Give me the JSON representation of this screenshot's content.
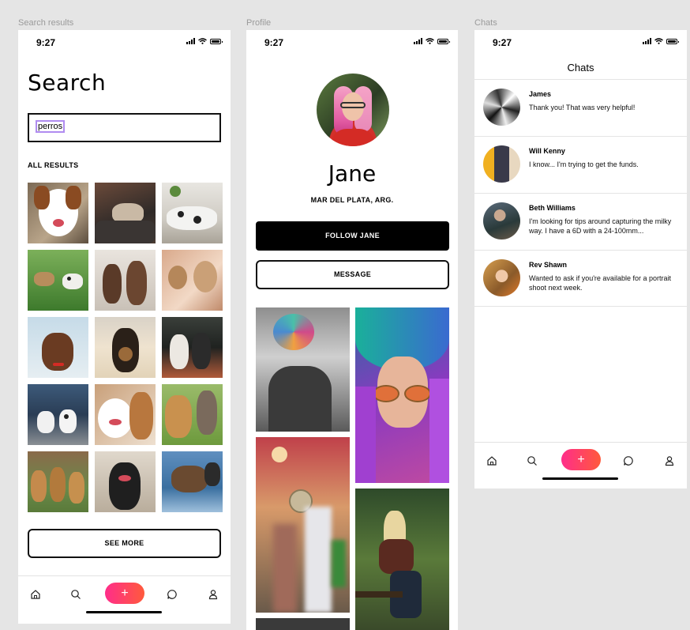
{
  "frames": {
    "search_label": "Search results",
    "profile_label": "Profile",
    "chats_label": "Chats"
  },
  "status": {
    "time": "9:27"
  },
  "search": {
    "title": "Search",
    "query": "perros",
    "section": "ALL RESULTS",
    "see_more": "SEE MORE"
  },
  "profile": {
    "name": "Jane",
    "location": "MAR DEL PLATA, ARG.",
    "follow": "FOLLOW JANE",
    "message": "MESSAGE"
  },
  "chats": {
    "title": "Chats",
    "items": [
      {
        "name": "James",
        "message": "Thank you! That was very helpful!"
      },
      {
        "name": "Will Kenny",
        "message": "I know... I'm trying to get the funds."
      },
      {
        "name": "Beth Williams",
        "message": "I'm looking for tips around capturing the milky way. I have a 6D with a 24-100mm..."
      },
      {
        "name": "Rev Shawn",
        "message": "Wanted to ask if you're available for a portrait shoot next week."
      }
    ]
  },
  "tabbar": {
    "icons": [
      "home-icon",
      "search-icon",
      "plus-icon",
      "chat-bubble-icon",
      "user-icon"
    ],
    "fab_label": "+"
  },
  "colors": {
    "fab_start": "#ff2d8a",
    "fab_end": "#ff5a3c",
    "query_highlight": "#b08cf0"
  }
}
